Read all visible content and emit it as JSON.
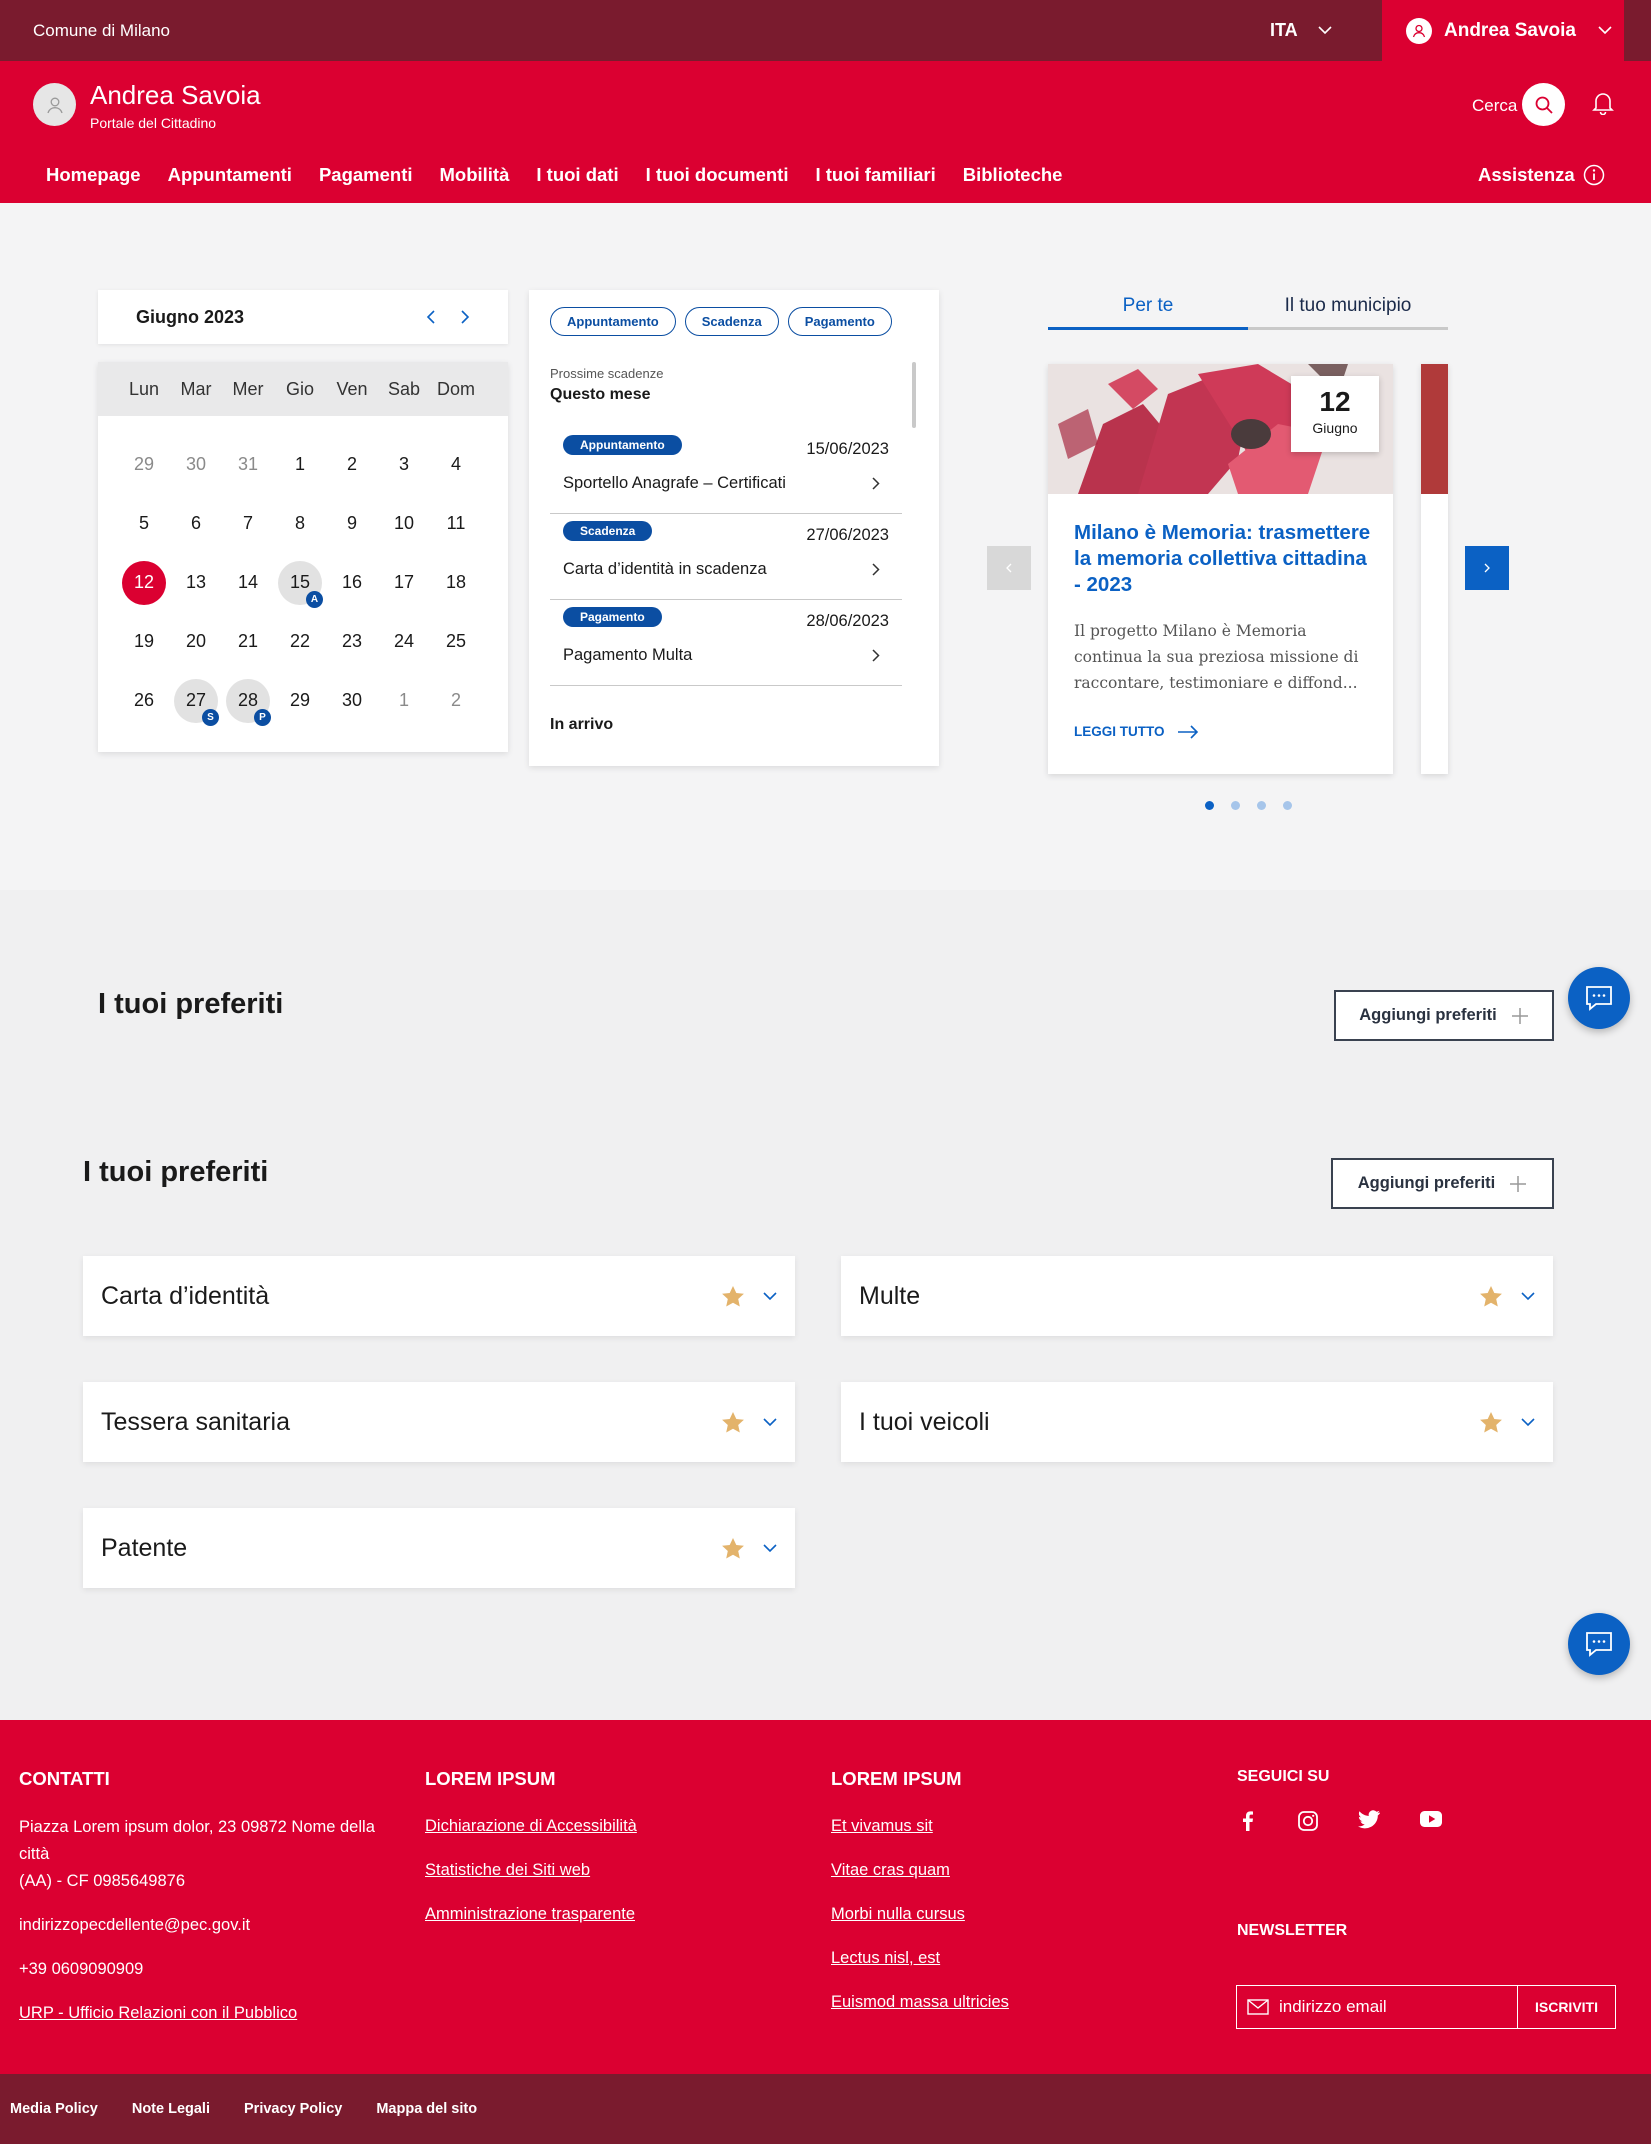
{
  "topbar": {
    "brand": "Comune di Milano",
    "language": "ITA",
    "user_name": "Andrea Savoia"
  },
  "header": {
    "title": "Andrea Savoia",
    "subtitle": "Portale del Cittadino",
    "search_label": "Cerca",
    "assist_label": "Assistenza"
  },
  "nav": [
    "Homepage",
    "Appuntamenti",
    "Pagamenti",
    "Mobilità",
    "I tuoi dati",
    "I tuoi documenti",
    "I tuoi familiari",
    "Biblioteche"
  ],
  "calendar": {
    "month_label": "Giugno 2023",
    "weekdays": [
      "Lun",
      "Mar",
      "Mer",
      "Gio",
      "Ven",
      "Sab",
      "Dom"
    ],
    "days": [
      {
        "n": "29",
        "muted": true
      },
      {
        "n": "30",
        "muted": true
      },
      {
        "n": "31",
        "muted": true
      },
      {
        "n": "1"
      },
      {
        "n": "2"
      },
      {
        "n": "3"
      },
      {
        "n": "4"
      },
      {
        "n": "5"
      },
      {
        "n": "6"
      },
      {
        "n": "7"
      },
      {
        "n": "8"
      },
      {
        "n": "9"
      },
      {
        "n": "10"
      },
      {
        "n": "11"
      },
      {
        "n": "12",
        "today": true
      },
      {
        "n": "13"
      },
      {
        "n": "14"
      },
      {
        "n": "15",
        "badge": "A"
      },
      {
        "n": "16"
      },
      {
        "n": "17"
      },
      {
        "n": "18"
      },
      {
        "n": "19"
      },
      {
        "n": "20"
      },
      {
        "n": "21"
      },
      {
        "n": "22"
      },
      {
        "n": "23"
      },
      {
        "n": "24"
      },
      {
        "n": "25"
      },
      {
        "n": "26"
      },
      {
        "n": "27",
        "badge": "S"
      },
      {
        "n": "28",
        "badge": "P"
      },
      {
        "n": "29"
      },
      {
        "n": "30"
      },
      {
        "n": "1",
        "muted": true
      },
      {
        "n": "2",
        "muted": true
      }
    ]
  },
  "deadlines": {
    "filters": [
      "Appuntamento",
      "Scadenza",
      "Pagamento"
    ],
    "label_upcoming": "Prossime scadenze",
    "label_month": "Questo mese",
    "items": [
      {
        "tag": "Appuntamento",
        "date": "15/06/2023",
        "text": "Sportello Anagrafe – Certificati"
      },
      {
        "tag": "Scadenza",
        "date": "27/06/2023",
        "text": "Carta d’identità in scadenza"
      },
      {
        "tag": "Pagamento",
        "date": "28/06/2023",
        "text": "Pagamento Multa"
      }
    ],
    "label_coming": "In arrivo"
  },
  "news": {
    "tabs": [
      "Per te",
      "Il tuo municipio"
    ],
    "card": {
      "day": "12",
      "month": "Giugno",
      "title": "Milano è Memoria: trasmettere la memoria collettiva cittadina - 2023",
      "description": "Il progetto Milano è Memoria continua la sua preziosa missione di raccontare, testimoniare e diffond...",
      "more": "LEGGI TUTTO"
    },
    "dots": 4
  },
  "favorites": {
    "title1": "I tuoi preferiti",
    "title2": "I tuoi preferiti",
    "add_label": "Aggiungi preferiti",
    "items": [
      "Carta d’identità",
      "Multe",
      "Tessera sanitaria",
      "I tuoi veicoli",
      "Patente"
    ]
  },
  "footer": {
    "contacts_title": "CONTATTI",
    "address_line1": "Piazza Lorem ipsum dolor, 23 09872 Nome della città",
    "address_line2": "(AA) - CF 0985649876",
    "email": "indirizzopecdellente@pec.gov.it",
    "phone": "+39 0609090909",
    "urp": "URP - Ufficio Relazioni con il Pubblico",
    "col2_title": "LOREM IPSUM",
    "col2_links": [
      "Dichiarazione di Accessibilità",
      "Statistiche dei Siti web",
      "Amministrazione trasparente"
    ],
    "col3_title": "LOREM IPSUM",
    "col3_links": [
      "Et vivamus sit",
      "Vitae cras quam",
      "Morbi nulla cursus",
      "Lectus nisl, est",
      "Euismod massa ultricies"
    ],
    "social_title": "SEGUICI SU",
    "newsletter_title": "NEWSLETTER",
    "newsletter_placeholder": "indirizzo email",
    "subscribe": "ISCRIVITI"
  },
  "bottom_links": [
    "Media Policy",
    "Note Legali",
    "Privacy Policy",
    "Mappa del sito"
  ],
  "colors": {
    "brand_red": "#db0031",
    "dark_red": "#7a1b2e",
    "blue": "#0b61c4",
    "dark_blue": "#0b4ea2",
    "star": "#e3b36b"
  }
}
